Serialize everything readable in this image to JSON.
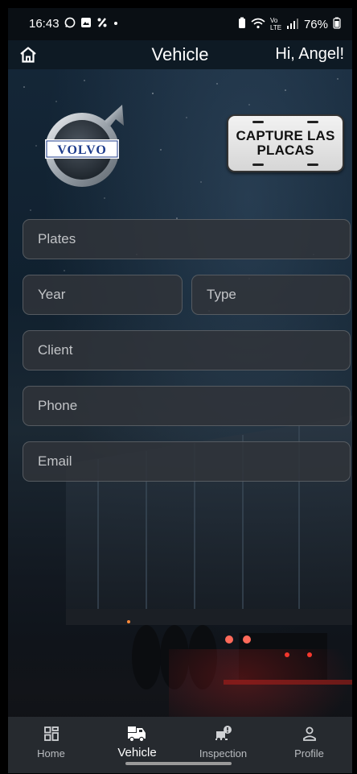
{
  "status_bar": {
    "time": "16:43",
    "left_icons": [
      "whatsapp-icon",
      "gallery-icon",
      "percent-icon",
      "dot-icon"
    ],
    "right_icons": [
      "battery-saver-icon",
      "wifi-icon",
      "volte-icon",
      "signal-icon"
    ],
    "volte_text": "Vo LTE",
    "battery_percent": "76%"
  },
  "app_bar": {
    "title": "Vehicle",
    "greeting": "Hi, Angel!"
  },
  "brand": {
    "logo_text": "VOLVO",
    "plate_button_label": "CAPTURE LAS PLACAS"
  },
  "form": {
    "plates_placeholder": "Plates",
    "year_placeholder": "Year",
    "type_placeholder": "Type",
    "client_placeholder": "Client",
    "phone_placeholder": "Phone",
    "email_placeholder": "Email"
  },
  "bottom_nav": {
    "items": [
      {
        "label": "Home",
        "icon": "dashboard-icon"
      },
      {
        "label": "Vehicle",
        "icon": "vehicle-icon",
        "active": true
      },
      {
        "label": "Inspection",
        "icon": "inspection-icon"
      },
      {
        "label": "Profile",
        "icon": "person-icon"
      }
    ]
  },
  "colors": {
    "field_bg": "#30343a",
    "nav_bg": "#262a2f",
    "accent_red": "#e23a2a"
  }
}
